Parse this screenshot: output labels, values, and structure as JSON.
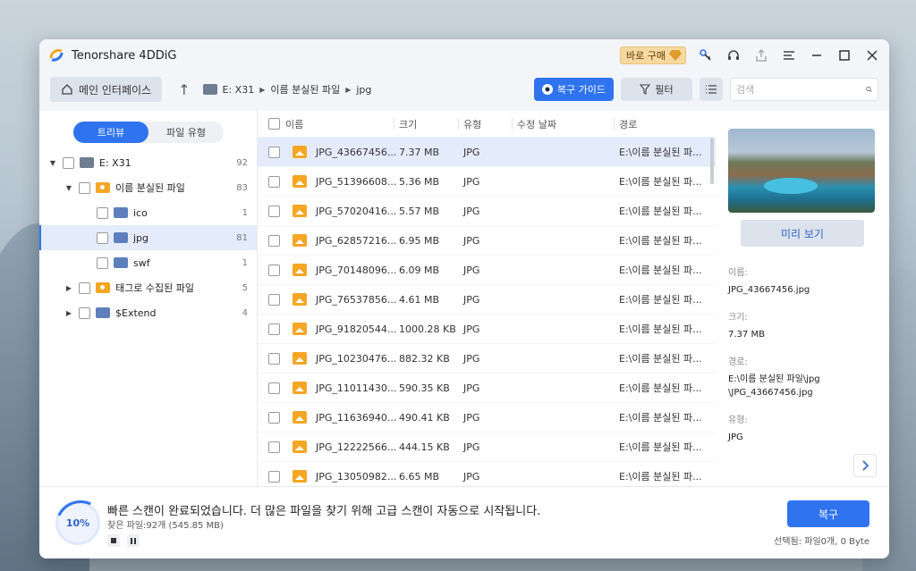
{
  "app": {
    "title": "Tenorshare 4DDiG",
    "buy_label": "바로 구매"
  },
  "nav": {
    "home_label": "메인 인터페이스",
    "breadcrumb": [
      "E: X31",
      "이름 분실된 파일",
      "jpg"
    ],
    "guide_label": "복구 가이드",
    "filter_label": "필터",
    "search_placeholder": "검색"
  },
  "tabs": [
    "트리뷰",
    "파일 유형"
  ],
  "tree": [
    {
      "label": "E: X31",
      "count": "92"
    },
    {
      "label": "이름 분실된 파일",
      "count": "83"
    },
    {
      "label": "ico",
      "count": "1"
    },
    {
      "label": "jpg",
      "count": "81"
    },
    {
      "label": "swf",
      "count": "1"
    },
    {
      "label": "태그로 수집된 파일",
      "count": "5"
    },
    {
      "label": "$Extend",
      "count": "4"
    }
  ],
  "table": {
    "headers": [
      "이름",
      "크기",
      "유형",
      "수정 날짜",
      "경로"
    ],
    "rows": [
      {
        "name": "JPG_43667456...",
        "size": "7.37 MB",
        "type": "JPG",
        "date": "",
        "path": "E:\\이름 분실된 파..."
      },
      {
        "name": "JPG_51396608...",
        "size": "5.36 MB",
        "type": "JPG",
        "date": "",
        "path": "E:\\이름 분실된 파..."
      },
      {
        "name": "JPG_57020416...",
        "size": "5.57 MB",
        "type": "JPG",
        "date": "",
        "path": "E:\\이름 분실된 파..."
      },
      {
        "name": "JPG_62857216...",
        "size": "6.95 MB",
        "type": "JPG",
        "date": "",
        "path": "E:\\이름 분실된 파..."
      },
      {
        "name": "JPG_70148096...",
        "size": "6.09 MB",
        "type": "JPG",
        "date": "",
        "path": "E:\\이름 분실된 파..."
      },
      {
        "name": "JPG_76537856...",
        "size": "4.61 MB",
        "type": "JPG",
        "date": "",
        "path": "E:\\이름 분실된 파..."
      },
      {
        "name": "JPG_91820544...",
        "size": "1000.28 KB",
        "type": "JPG",
        "date": "",
        "path": "E:\\이름 분실된 파..."
      },
      {
        "name": "JPG_10230476...",
        "size": "882.32 KB",
        "type": "JPG",
        "date": "",
        "path": "E:\\이름 분실된 파..."
      },
      {
        "name": "JPG_11011430...",
        "size": "590.35 KB",
        "type": "JPG",
        "date": "",
        "path": "E:\\이름 분실된 파..."
      },
      {
        "name": "JPG_11636940...",
        "size": "490.41 KB",
        "type": "JPG",
        "date": "",
        "path": "E:\\이름 분실된 파..."
      },
      {
        "name": "JPG_12222566...",
        "size": "444.15 KB",
        "type": "JPG",
        "date": "",
        "path": "E:\\이름 분실된 파..."
      },
      {
        "name": "JPG_13050982...",
        "size": "6.65 MB",
        "type": "JPG",
        "date": "",
        "path": "E:\\이름 분실된 파..."
      }
    ]
  },
  "preview": {
    "button_label": "미리 보기",
    "name_label": "이름:",
    "name_value": "JPG_43667456.jpg",
    "size_label": "크기:",
    "size_value": "7.37 MB",
    "path_label": "경로:",
    "path_value_1": "E:\\이름 분실된 파일\\jpg",
    "path_value_2": "\\JPG_43667456.jpg",
    "type_label": "유형:",
    "type_value": "JPG"
  },
  "bottom": {
    "progress": "10%",
    "status": "빠른 스캔이 완료되었습니다. 더 많은 파일을 찾기 위해 고급 스캔이 자동으로 시작됩니다.",
    "found": "찾은 파일:92개 (545.85 MB)",
    "recover_label": "복구",
    "selected": "선택됨: 파일0개, 0 Byte"
  },
  "colors": {
    "accent": "#2f74ee",
    "folder": "#5d7fbd",
    "image": "#f5a623"
  }
}
